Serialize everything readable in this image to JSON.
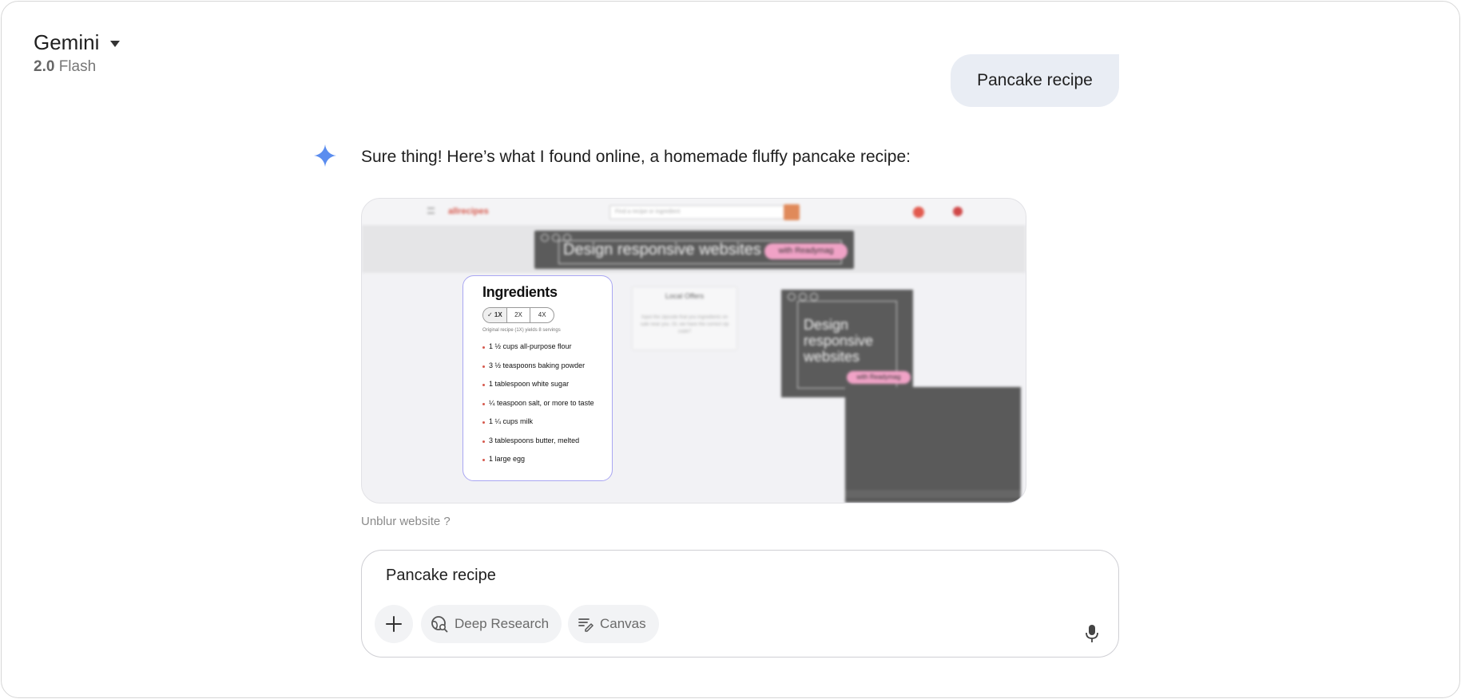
{
  "header": {
    "model_name": "Gemini",
    "model_version_number": "2.0",
    "model_version_label": "Flash"
  },
  "conversation": {
    "user_message": "Pancake recipe",
    "assistant_intro": "Sure thing! Here’s what I found online, a homemade fluffy pancake recipe:",
    "website_preview": {
      "site_logo": "allrecipes",
      "search_placeholder": "Find a recipe or ingredient",
      "ad_headline": "Design responsive websites",
      "ad_pill": "with Readymag",
      "ad_side_lines": [
        "Design",
        "responsive",
        "websites"
      ],
      "local_offers_title": "Local Offers",
      "local_offers_text": "Input the zipcode that you ingredients on sale near you. Or, we have the correct zip code?",
      "ingredients": {
        "title": "Ingredients",
        "scales": [
          "✓ 1X",
          "2X",
          "4X"
        ],
        "selected_scale": "1X",
        "yield_note": "Original recipe (1X) yields 8 servings",
        "items": [
          "1 ½ cups all-purpose flour",
          "3 ½ teaspoons baking powder",
          "1 tablespoon white sugar",
          "¼ teaspoon salt, or more to taste",
          "1 ¼ cups milk",
          "3 tablespoons butter, melted",
          "1 large egg"
        ]
      }
    },
    "unblur_link": "Unblur website ?"
  },
  "composer": {
    "input_value": "Pancake recipe",
    "deep_research_label": "Deep Research",
    "canvas_label": "Canvas"
  },
  "colors": {
    "accent_spark": "#5b8def",
    "user_bubble_bg": "#e9edf4",
    "ingredients_border": "#a9a6f2"
  },
  "icons": {
    "model_dropdown": "caret-down-icon",
    "assistant": "gemini-spark-icon",
    "plus": "plus-icon",
    "deep_research": "globe-search-icon",
    "canvas": "canvas-edit-icon",
    "mic": "microphone-icon"
  }
}
